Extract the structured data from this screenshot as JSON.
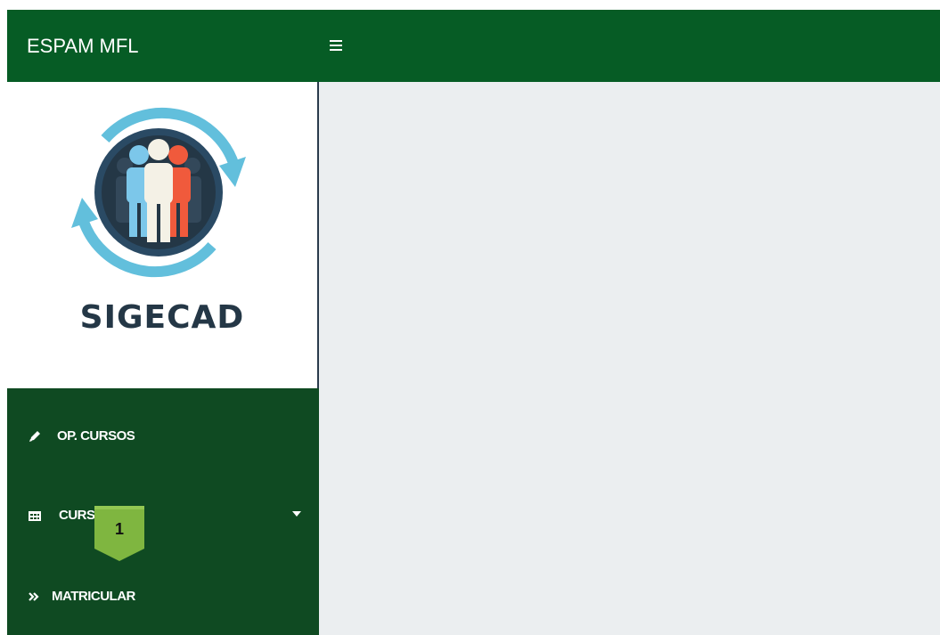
{
  "header": {
    "brand": "ESPAM MFL"
  },
  "logo": {
    "text": "SIGECAD"
  },
  "sidebar": {
    "items": [
      {
        "label": "OP. CURSOS",
        "icon": "pencil-icon"
      },
      {
        "label": "CURSOS",
        "icon": "table-icon",
        "has_dropdown": true
      },
      {
        "label": "MATRICULAR",
        "icon": "double-chevron-right-icon"
      }
    ]
  },
  "callout": {
    "number": "1"
  },
  "colors": {
    "header_bg": "#065c25",
    "sidebar_bg": "#0f4a22",
    "content_bg": "#ebeef0",
    "badge": "#7fb640"
  }
}
